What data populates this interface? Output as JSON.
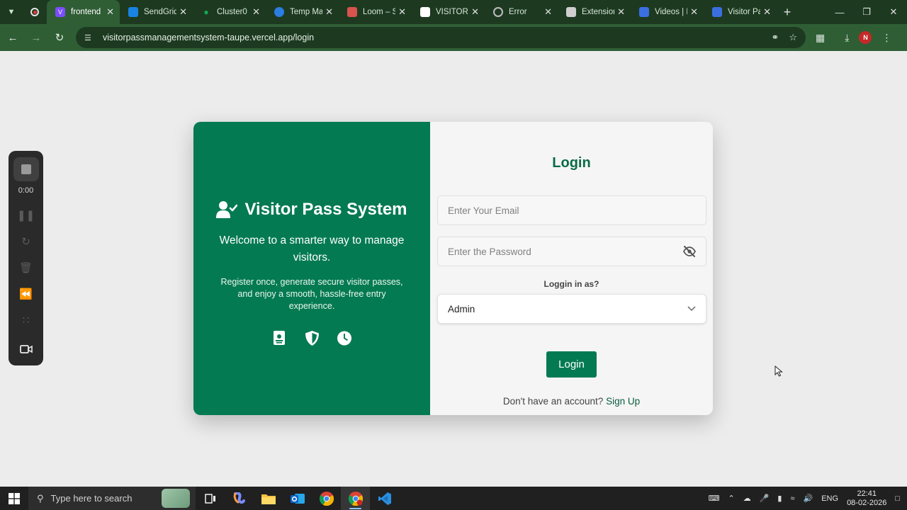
{
  "browser": {
    "tabs": [
      {
        "label": "frontend",
        "active": true,
        "color": "#7b4dff"
      },
      {
        "label": "SendGrid",
        "active": false,
        "color": "#1a82e2"
      },
      {
        "label": "Cluster0 |",
        "active": false,
        "color": "#13aa52"
      },
      {
        "label": "Temp Ma",
        "active": false,
        "color": "#2a7de1"
      },
      {
        "label": "Loom – S",
        "active": false,
        "color": "#d9534f"
      },
      {
        "label": "VISITOR-",
        "active": false,
        "color": "#ffffff"
      },
      {
        "label": "Error",
        "active": false,
        "color": "#9e9e9e"
      },
      {
        "label": "Extension",
        "active": false,
        "color": "#cfcfcf"
      },
      {
        "label": "Videos | L",
        "active": false,
        "color": "#3b6fe0"
      },
      {
        "label": "Visitor Pa",
        "active": false,
        "color": "#3b6fe0"
      }
    ],
    "url": "visitorpassmanagementsystem-taupe.vercel.app/login",
    "profile_initial": "N"
  },
  "recorder": {
    "time": "0:00"
  },
  "left_panel": {
    "brand": "Visitor Pass System",
    "welcome": "Welcome to a smarter way to manage visitors.",
    "description": "Register once, generate secure visitor passes, and enjoy a smooth, hassle-free entry experience.",
    "accent_color": "#047a52"
  },
  "login": {
    "title": "Login",
    "email_placeholder": "Enter Your Email",
    "password_placeholder": "Enter the Password",
    "role_label": "Loggin in as?",
    "role_selected": "Admin",
    "button_label": "Login",
    "signup_prompt": "Don't have an account?",
    "signup_link": "Sign Up"
  },
  "taskbar": {
    "search_placeholder": "Type here to search",
    "language": "ENG",
    "time": "22:41",
    "date": "08-02-2026"
  }
}
